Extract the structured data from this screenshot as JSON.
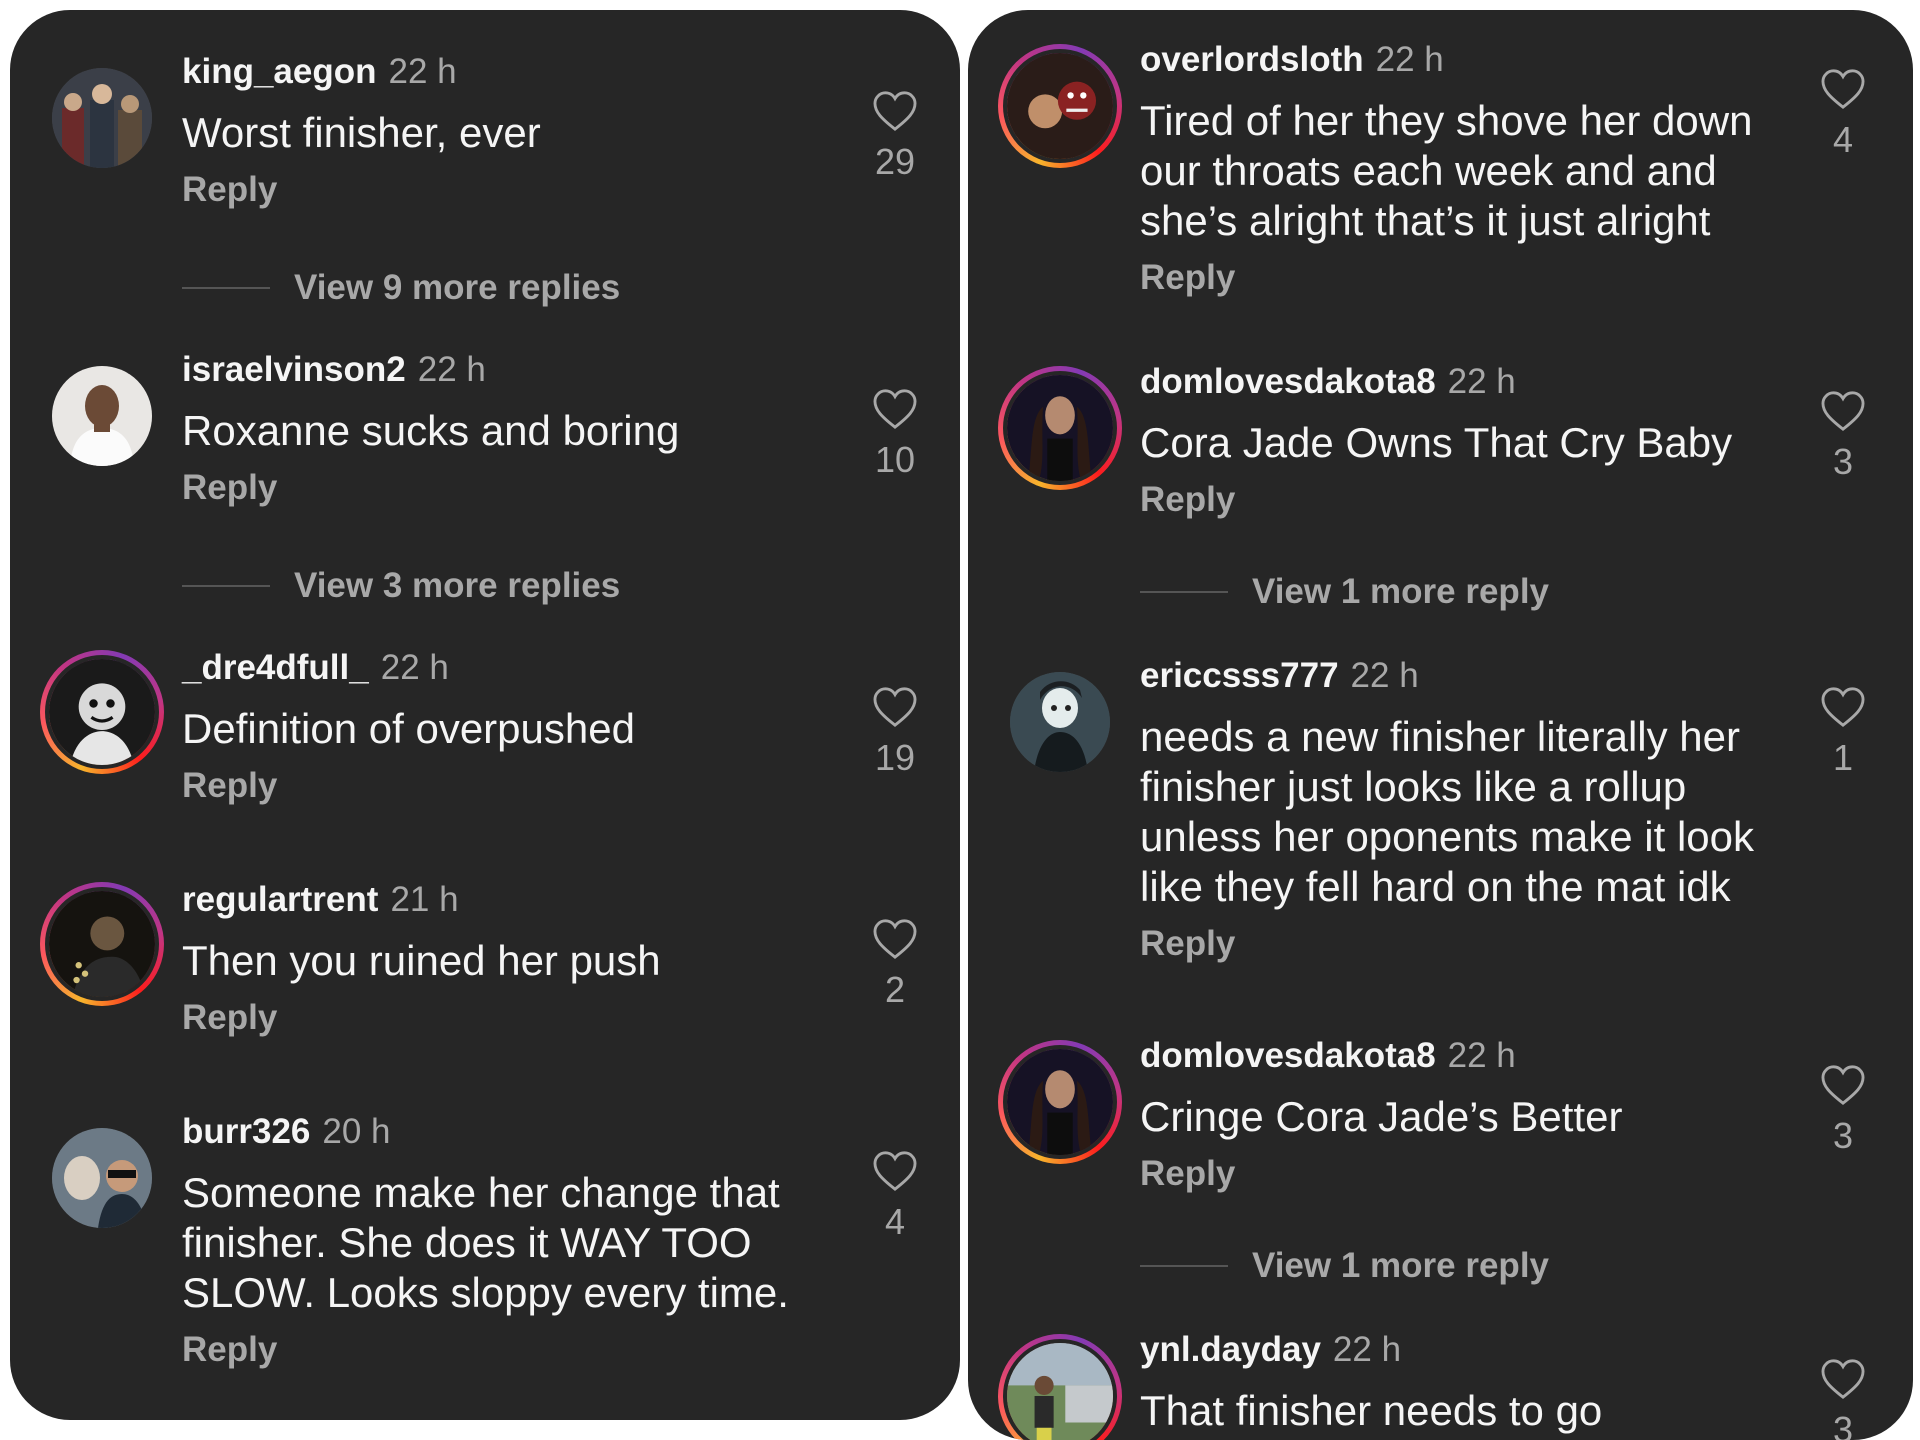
{
  "left_panel": {
    "comments": [
      {
        "user": "king_aegon",
        "time": "22 h",
        "text": "Worst finisher, ever",
        "reply": "Reply",
        "likes": "29",
        "avatar": "group-photo-avatar",
        "more_replies": "View 9 more replies"
      },
      {
        "user": "israelvinson2",
        "time": "22 h",
        "text": "Roxanne sucks and boring",
        "reply": "Reply",
        "likes": "10",
        "avatar": "man-white-shirt-avatar",
        "more_replies": "View 3 more replies"
      },
      {
        "user": "_dre4dfull_",
        "time": "22 h",
        "text": "Definition of overpushed",
        "reply": "Reply",
        "likes": "19",
        "avatar": "cartoon-avatar"
      },
      {
        "user": "regulartrent",
        "time": "21 h",
        "text": "Then you ruined her push",
        "reply": "Reply",
        "likes": "2",
        "avatar": "night-photo-avatar"
      },
      {
        "user": "burr326",
        "time": "20 h",
        "text": "Someone make her change that finisher.  She does it WAY TOO SLOW.  Looks sloppy every time.",
        "reply": "Reply",
        "likes": "4",
        "avatar": "selfie-with-dog-avatar"
      }
    ]
  },
  "right_panel": {
    "comments": [
      {
        "user": "overlordsloth",
        "time": "22 h",
        "text": "Tired of her they shove her down our throats each week and and she’s alright that’s it just alright",
        "reply": "Reply",
        "likes": "4",
        "avatar": "masked-wrestlers-avatar"
      },
      {
        "user": "domlovesdakota8",
        "time": "22 h",
        "text": "Cora Jade Owns That Cry Baby",
        "reply": "Reply",
        "likes": "3",
        "avatar": "wrestler-avatar",
        "more_replies": "View 1 more reply"
      },
      {
        "user": "ericcsss777",
        "time": "22 h",
        "text": "needs a new finisher literally her finisher just looks like a rollup unless her oponents make it look like they fell hard on the mat idk",
        "reply": "Reply",
        "likes": "1",
        "avatar": "animated-character-avatar"
      },
      {
        "user": "domlovesdakota8",
        "time": "22 h",
        "text": "Cringe Cora Jade’s Better",
        "reply": "Reply",
        "likes": "3",
        "avatar": "wrestler-avatar",
        "more_replies": "View 1 more reply"
      },
      {
        "user": "ynl.dayday",
        "time": "22 h",
        "text": "That finisher needs to go",
        "reply": "",
        "likes": "3",
        "avatar": "outdoor-photo-avatar"
      }
    ]
  },
  "colors": {
    "panel_bg": "#262626",
    "text_primary": "#f5f5f5",
    "text_secondary": "#a8a8a8"
  }
}
